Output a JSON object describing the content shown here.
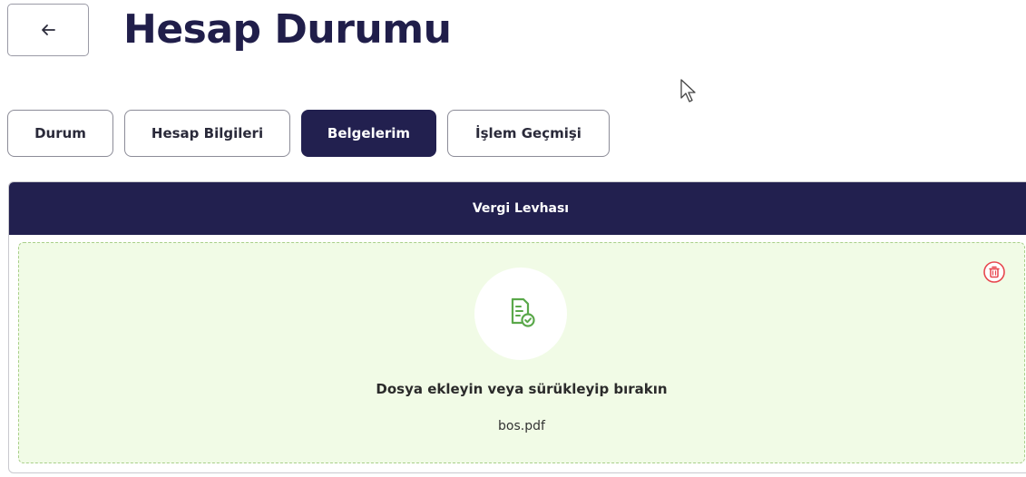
{
  "header": {
    "back_icon": "arrow-left-icon",
    "title": "Hesap Durumu"
  },
  "tabs": [
    {
      "label": "Durum",
      "active": false
    },
    {
      "label": "Hesap Bilgileri",
      "active": false
    },
    {
      "label": "Belgelerim",
      "active": true
    },
    {
      "label": "İşlem Geçmişi",
      "active": false
    }
  ],
  "panel": {
    "title": "Vergi Levhası",
    "dropzone": {
      "icon": "document-check-icon",
      "instruction": "Dosya ekleyin veya sürükleyip bırakın",
      "file_name": "bos.pdf",
      "delete_icon": "trash-icon"
    }
  },
  "colors": {
    "primary": "#22204f",
    "dropzone_bg": "#f1fbe6",
    "dropzone_border": "#a9cf8a",
    "success_icon": "#5aa84a",
    "danger_icon": "#e8474f"
  }
}
